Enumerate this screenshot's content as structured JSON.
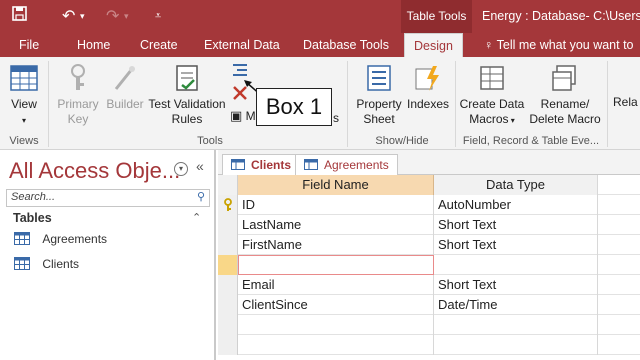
{
  "titlebar": {
    "context_tab": "Table Tools",
    "window_title": "Energy : Database- C:\\Users\\C"
  },
  "ribbon_tabs": [
    {
      "label": "File"
    },
    {
      "label": "Home"
    },
    {
      "label": "Create"
    },
    {
      "label": "External Data"
    },
    {
      "label": "Database Tools"
    },
    {
      "label": "Design"
    }
  ],
  "tell_me": "Tell me what you want to",
  "ribbon": {
    "view": "View",
    "primary_key_line1": "Primary",
    "primary_key_line2": "Key",
    "builder": "Builder",
    "test_validation_line1": "Test Validation",
    "test_validation_line2": "Rules",
    "modify_partial": "M",
    "lookups_partial": "s",
    "property_sheet_line1": "Property",
    "property_sheet_line2": "Sheet",
    "indexes": "Indexes",
    "create_data_macros_line1": "Create Data",
    "create_data_macros_line2": "Macros",
    "rename_delete_line1": "Rename/",
    "rename_delete_line2": "Delete Macro",
    "relationships_partial": "Rela",
    "groups": {
      "views": "Views",
      "tools": "Tools",
      "show_hide": "Show/Hide",
      "field_record_events": "Field, Record & Table Eve..."
    }
  },
  "callout": "Box 1",
  "nav": {
    "title": "All Access Obje...",
    "search_placeholder": "Search...",
    "section": "Tables",
    "items": [
      {
        "label": "Agreements"
      },
      {
        "label": "Clients"
      }
    ]
  },
  "doc_tabs": [
    {
      "label": "Clients"
    },
    {
      "label": "Agreements"
    }
  ],
  "grid": {
    "headers": {
      "field_name": "Field Name",
      "data_type": "Data Type"
    },
    "rows": [
      {
        "field": "ID",
        "type": "AutoNumber"
      },
      {
        "field": "LastName",
        "type": "Short Text"
      },
      {
        "field": "FirstName",
        "type": "Short Text"
      },
      {
        "field": "",
        "type": ""
      },
      {
        "field": "Email",
        "type": "Short Text"
      },
      {
        "field": "ClientSince",
        "type": "Date/Time"
      },
      {
        "field": "",
        "type": ""
      },
      {
        "field": "",
        "type": ""
      }
    ]
  },
  "colors": {
    "accent": "#a4373a",
    "header_highlight": "#f7d9b0"
  }
}
